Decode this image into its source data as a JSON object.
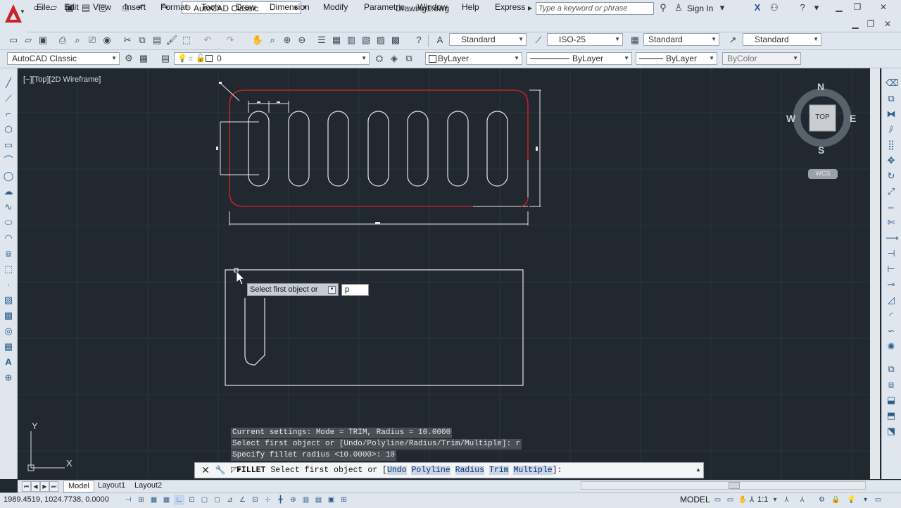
{
  "titlebar": {
    "workspace": "AutoCAD Classic",
    "document_title": "Drawing1.dwg",
    "search_placeholder": "Type a keyword or phrase",
    "sign_in": "Sign In"
  },
  "menu": [
    "File",
    "Edit",
    "View",
    "Insert",
    "Format",
    "Tools",
    "Draw",
    "Dimension",
    "Modify",
    "Parametric",
    "Window",
    "Help",
    "Express"
  ],
  "toolbar1": {
    "text_style": "Standard",
    "dim_style": "ISO-25",
    "table_style": "Standard",
    "mleader_style": "Standard"
  },
  "toolbar2": {
    "workspace": "AutoCAD Classic",
    "layer": "0",
    "color": "ByLayer",
    "linetype": "ByLayer",
    "lineweight": "ByLayer",
    "plotstyle": "ByColor"
  },
  "viewport": {
    "label": "[−][Top][2D Wireframe]",
    "viewcube": {
      "n": "N",
      "s": "S",
      "e": "E",
      "w": "W",
      "face": "TOP",
      "wcs": "WCS"
    },
    "ucs": {
      "y": "Y",
      "x": "X"
    }
  },
  "dynamic_input": {
    "prompt": "Select first object or",
    "value": "p"
  },
  "command_history": [
    "Current settings: Mode = TRIM, Radius = 10.0000",
    "Select first object or [Undo/Polyline/Radius/Trim/Multiple]: r",
    "Specify fillet radius <10.0000>: 10"
  ],
  "command_line": {
    "command": "FILLET",
    "prompt": "Select first object or [",
    "options": [
      "Undo",
      "Polyline",
      "Radius",
      "Trim",
      "Multiple"
    ],
    "suffix": "]:"
  },
  "layout_tabs": [
    "Model",
    "Layout1",
    "Layout2"
  ],
  "status": {
    "coords": "1989.4519, 1024.7738, 0.0000",
    "space": "MODEL",
    "scale": "1:1"
  },
  "colors": {
    "canvas": "#212830",
    "highlight_red": "#c0202a",
    "chrome": "#dfe6ee"
  }
}
